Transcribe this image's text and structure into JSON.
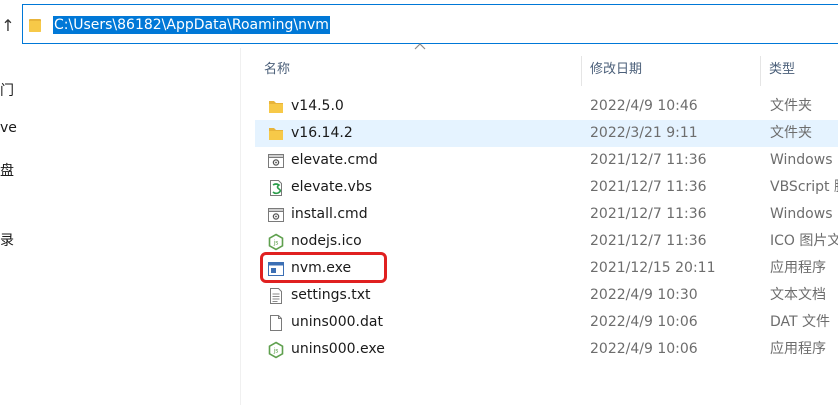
{
  "address": {
    "path": "C:\\Users\\86182\\AppData\\Roaming\\nvm"
  },
  "nav_fragments": [
    "门",
    "ve",
    "盘",
    "录"
  ],
  "columns": {
    "name": "名称",
    "modified": "修改日期",
    "type": "类型"
  },
  "files": [
    {
      "name": "v14.5.0",
      "modified": "2022/4/9 10:46",
      "type": "文件夹",
      "icon": "folder-icon"
    },
    {
      "name": "v16.14.2",
      "modified": "2022/3/21 9:11",
      "type": "文件夹",
      "icon": "folder-icon"
    },
    {
      "name": "elevate.cmd",
      "modified": "2021/12/7 11:36",
      "type": "Windows",
      "icon": "cmd-script-icon"
    },
    {
      "name": "elevate.vbs",
      "modified": "2021/12/7 11:36",
      "type": "VBScript 脚",
      "icon": "vbs-script-icon"
    },
    {
      "name": "install.cmd",
      "modified": "2021/12/7 11:36",
      "type": "Windows",
      "icon": "cmd-script-icon"
    },
    {
      "name": "nodejs.ico",
      "modified": "2021/12/7 11:36",
      "type": "ICO 图片文",
      "icon": "nodejs-icon"
    },
    {
      "name": "nvm.exe",
      "modified": "2021/12/15 20:11",
      "type": "应用程序",
      "icon": "exe-app-icon"
    },
    {
      "name": "settings.txt",
      "modified": "2022/4/9 10:30",
      "type": "文本文档",
      "icon": "text-file-icon"
    },
    {
      "name": "unins000.dat",
      "modified": "2022/4/9 10:06",
      "type": "DAT 文件",
      "icon": "blank-file-icon"
    },
    {
      "name": "unins000.exe",
      "modified": "2022/4/9 10:06",
      "type": "应用程序",
      "icon": "nodejs-icon"
    }
  ],
  "colors": {
    "accent": "#0078d7",
    "selection": "#e5f3ff",
    "highlight": "#e02020",
    "folder": "#f7c948"
  }
}
